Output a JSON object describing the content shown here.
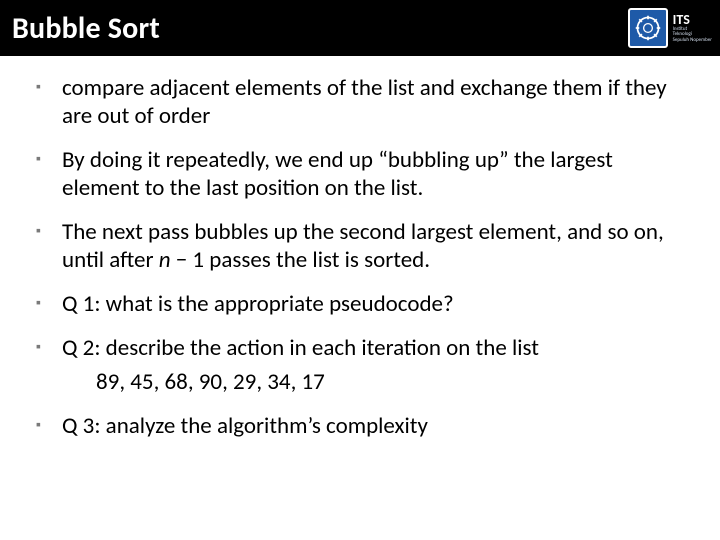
{
  "header": {
    "title": "Bubble Sort",
    "logo": {
      "abbrev": "ITS",
      "sub1": "Institut",
      "sub2": "Teknologi",
      "sub3": "Sepuluh Nopember"
    }
  },
  "bullets": [
    {
      "text": "compare adjacent elements of the list and exchange them if they are out of order"
    },
    {
      "text": "By doing it repeatedly, we end up “bubbling up” the largest element to the last position on the list."
    },
    {
      "text_pre": "The next pass bubbles up the second largest element, and so on, until after ",
      "n": "n",
      "text_post": " − 1 passes the list is sorted."
    },
    {
      "text": "Q 1: what is the appropriate pseudocode?"
    },
    {
      "text": "Q 2: describe the action in each iteration on the list"
    },
    {
      "indent_text": "89, 45, 68, 90, 29, 34, 17"
    },
    {
      "text": "Q 3: analyze the algorithm’s complexity"
    }
  ]
}
